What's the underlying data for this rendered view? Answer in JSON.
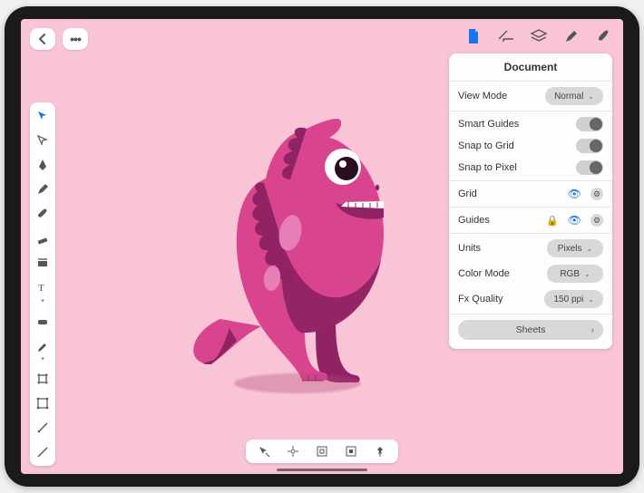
{
  "topRight": {
    "icons": [
      "document-icon",
      "ruler-icon",
      "layers-icon",
      "pencil-icon",
      "brush-icon"
    ],
    "activeIndex": 0
  },
  "leftTools": [
    "move-tool",
    "node-tool",
    "pen-tool",
    "pencil-tool",
    "brush-tool",
    "eraser-tool",
    "shape-tool",
    "text-tool",
    "gradient-tool",
    "color-picker-tool",
    "artboard-tool",
    "crop-tool",
    "slice-tool",
    "line-tool"
  ],
  "leftActiveIndex": 0,
  "bottomTools": [
    "cursor-snap-icon",
    "align-center-icon",
    "bounds-off-icon",
    "bounds-on-icon",
    "pin-icon"
  ],
  "panel": {
    "title": "Document",
    "viewMode": {
      "label": "View Mode",
      "value": "Normal"
    },
    "smartGuides": {
      "label": "Smart Guides",
      "on": false
    },
    "snapGrid": {
      "label": "Snap to Grid",
      "on": false
    },
    "snapPixel": {
      "label": "Snap to Pixel",
      "on": false
    },
    "grid": {
      "label": "Grid"
    },
    "guides": {
      "label": "Guides"
    },
    "units": {
      "label": "Units",
      "value": "Pixels"
    },
    "colorMode": {
      "label": "Color Mode",
      "value": "RGB"
    },
    "fxQuality": {
      "label": "Fx Quality",
      "value": "150 ppi"
    },
    "sheets": {
      "label": "Sheets"
    }
  },
  "colors": {
    "canvas": "#f9c4d6",
    "dinoMain": "#d9448f",
    "dinoDark": "#8f2364",
    "dinoLight": "#e77eb6",
    "eyeRing": "#ffffff",
    "eyeDark": "#2b0d1f"
  }
}
